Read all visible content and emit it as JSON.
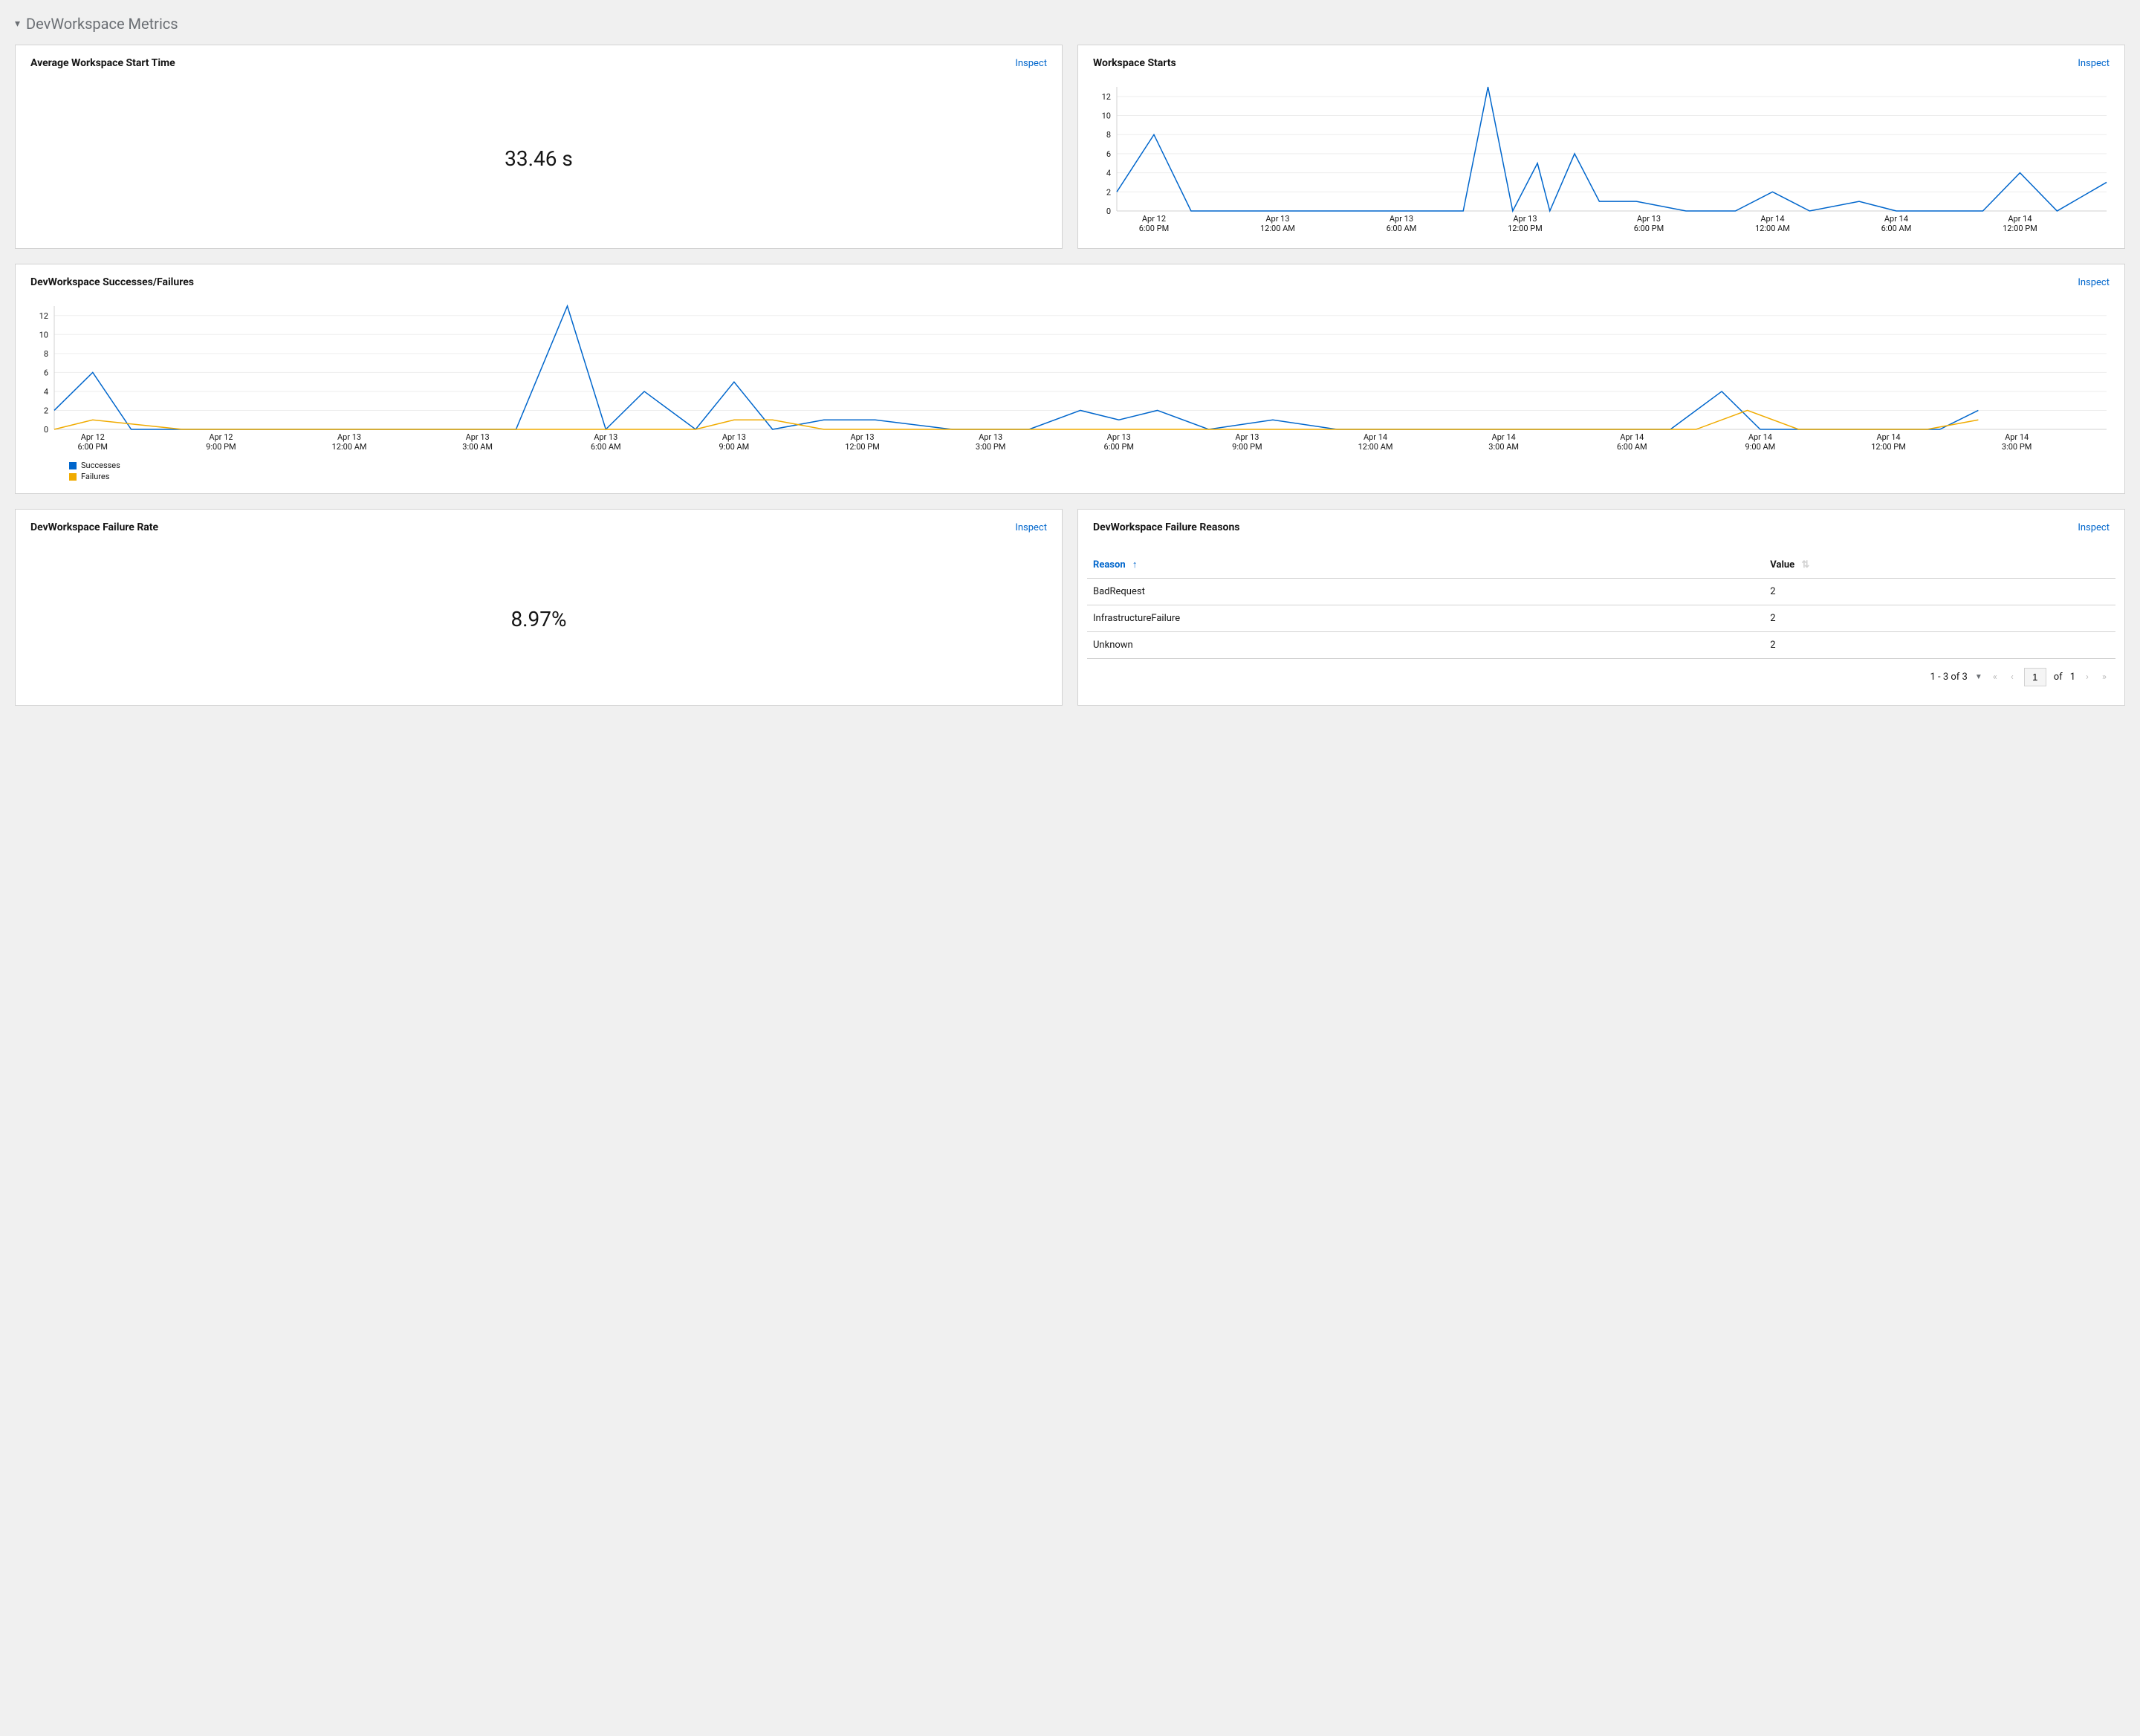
{
  "section": {
    "title": "DevWorkspace Metrics"
  },
  "labels": {
    "inspect": "Inspect",
    "reason": "Reason",
    "value": "Value",
    "of": "of"
  },
  "colors": {
    "series_primary": "#0066cc",
    "series_secondary": "#f0ab00",
    "grid": "#ededed",
    "axis": "#d2d2d2"
  },
  "panels": {
    "avg_start": {
      "title": "Average Workspace Start Time",
      "value": "33.46 s"
    },
    "starts": {
      "title": "Workspace Starts"
    },
    "succ_fail": {
      "title": "DevWorkspace Successes/Failures",
      "legend": {
        "s": "Successes",
        "f": "Failures"
      }
    },
    "failure_rate": {
      "title": "DevWorkspace Failure Rate",
      "value": "8.97%"
    },
    "failure_reasons": {
      "title": "DevWorkspace Failure Reasons"
    }
  },
  "failure_reasons_table": {
    "rows": [
      {
        "reason": "BadRequest",
        "value": "2"
      },
      {
        "reason": "InfrastructureFailure",
        "value": "2"
      },
      {
        "reason": "Unknown",
        "value": "2"
      }
    ],
    "pager": {
      "range": "1 - 3 of 3",
      "page": "1",
      "total": "1"
    }
  },
  "chart_data": [
    {
      "id": "workspace_starts",
      "type": "line",
      "title": "Workspace Starts",
      "xlabel": "",
      "ylabel": "",
      "ylim": [
        0,
        13
      ],
      "yticks": [
        0,
        2,
        4,
        6,
        8,
        10,
        12
      ],
      "x_tick_labels": [
        [
          "Apr 12",
          "6:00 PM"
        ],
        [
          "Apr 13",
          "12:00 AM"
        ],
        [
          "Apr 13",
          "6:00 AM"
        ],
        [
          "Apr 13",
          "12:00 PM"
        ],
        [
          "Apr 13",
          "6:00 PM"
        ],
        [
          "Apr 14",
          "12:00 AM"
        ],
        [
          "Apr 14",
          "6:00 AM"
        ],
        [
          "Apr 14",
          "12:00 PM"
        ]
      ],
      "series": [
        {
          "name": "Starts",
          "color": "#0066cc",
          "idx": [
            0,
            0.3,
            0.6,
            1,
            2,
            2.8,
            3.0,
            3.2,
            3.4,
            3.5,
            3.7,
            3.9,
            4.2,
            4.6,
            5.0,
            5.3,
            5.6,
            6.0,
            6.3,
            6.7,
            7.0,
            7.3,
            7.6,
            8.0
          ],
          "values": [
            2,
            8,
            0,
            0,
            0,
            0,
            13,
            0,
            5,
            0,
            6,
            1,
            1,
            0,
            0,
            2,
            0,
            1,
            0,
            0,
            0,
            4,
            0,
            3
          ]
        }
      ]
    },
    {
      "id": "succ_fail",
      "type": "line",
      "title": "DevWorkspace Successes/Failures",
      "xlabel": "",
      "ylabel": "",
      "ylim": [
        0,
        13
      ],
      "yticks": [
        0,
        2,
        4,
        6,
        8,
        10,
        12
      ],
      "x_tick_labels": [
        [
          "Apr 12",
          "6:00 PM"
        ],
        [
          "Apr 12",
          "9:00 PM"
        ],
        [
          "Apr 13",
          "12:00 AM"
        ],
        [
          "Apr 13",
          "3:00 AM"
        ],
        [
          "Apr 13",
          "6:00 AM"
        ],
        [
          "Apr 13",
          "9:00 AM"
        ],
        [
          "Apr 13",
          "12:00 PM"
        ],
        [
          "Apr 13",
          "3:00 PM"
        ],
        [
          "Apr 13",
          "6:00 PM"
        ],
        [
          "Apr 13",
          "9:00 PM"
        ],
        [
          "Apr 14",
          "12:00 AM"
        ],
        [
          "Apr 14",
          "3:00 AM"
        ],
        [
          "Apr 14",
          "6:00 AM"
        ],
        [
          "Apr 14",
          "9:00 AM"
        ],
        [
          "Apr 14",
          "12:00 PM"
        ],
        [
          "Apr 14",
          "3:00 PM"
        ]
      ],
      "series": [
        {
          "name": "Successes",
          "color": "#0066cc",
          "idx": [
            0,
            0.3,
            0.6,
            1,
            2,
            3,
            3.6,
            4.0,
            4.3,
            4.6,
            5.0,
            5.3,
            5.6,
            6.0,
            6.4,
            7.0,
            7.6,
            8.0,
            8.3,
            8.6,
            9.0,
            9.5,
            10,
            11,
            12,
            12.6,
            13.0,
            13.3,
            13.6,
            14.0,
            14.7,
            15.0
          ],
          "values": [
            2,
            6,
            0,
            0,
            0,
            0,
            0,
            13,
            0,
            4,
            0,
            5,
            0,
            1,
            1,
            0,
            0,
            2,
            1,
            2,
            0,
            1,
            0,
            0,
            0,
            0,
            4,
            0,
            0,
            0,
            0,
            2
          ]
        },
        {
          "name": "Failures",
          "color": "#f0ab00",
          "idx": [
            0,
            0.3,
            1,
            3,
            4,
            5,
            5.3,
            5.6,
            6,
            8,
            9,
            10,
            12.8,
            13.2,
            13.6,
            14.6,
            15.0
          ],
          "values": [
            0,
            1,
            0,
            0,
            0,
            0,
            1,
            1,
            0,
            0,
            0,
            0,
            0,
            2,
            0,
            0,
            1
          ]
        }
      ]
    }
  ]
}
